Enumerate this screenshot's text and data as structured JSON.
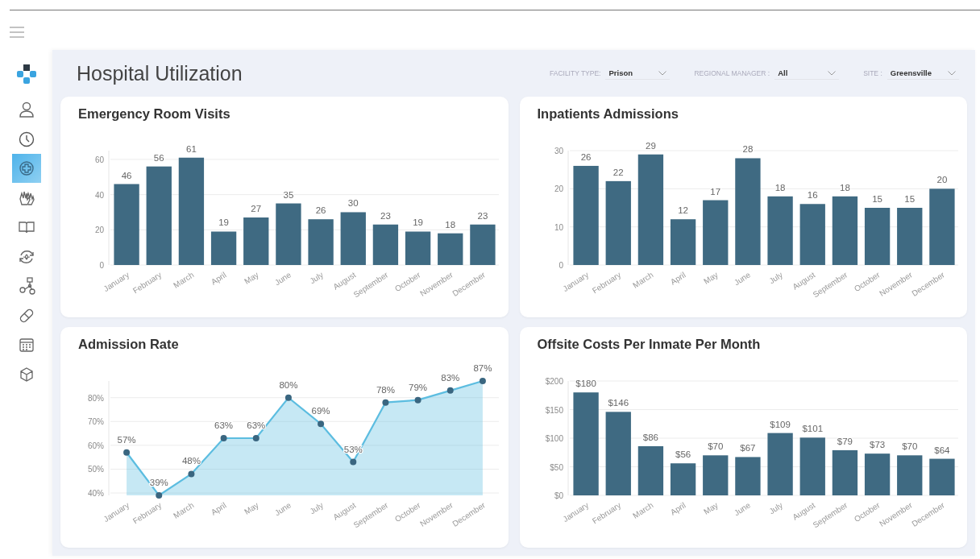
{
  "sidebar": {
    "items": [
      {
        "selected": false
      },
      {
        "selected": false
      },
      {
        "selected": true
      },
      {
        "selected": false
      },
      {
        "selected": false
      },
      {
        "selected": false
      },
      {
        "selected": false
      },
      {
        "selected": false
      },
      {
        "selected": false
      },
      {
        "selected": false
      }
    ]
  },
  "header": {
    "title": "Hospital Utilization"
  },
  "filters": [
    {
      "label": "FACILITY TYPE:",
      "value": "Prison"
    },
    {
      "label": "REGIONAL MANAGER :",
      "value": "All"
    },
    {
      "label": "SITE :",
      "value": "Greensville"
    }
  ],
  "cards": [
    {
      "title": "Emergency Room Visits",
      "chart_data": {
        "type": "bar",
        "categories": [
          "January",
          "February",
          "March",
          "April",
          "May",
          "June",
          "July",
          "August",
          "September",
          "October",
          "November",
          "December"
        ],
        "series": [
          {
            "color": "#3f6a82",
            "values": [
              46,
              56,
              61,
              19,
              27,
              35,
              26,
              30,
              23,
              19,
              18,
              23
            ]
          }
        ],
        "grid": true,
        "ylim": [
          0,
          65
        ],
        "yticks": [
          0,
          20,
          40,
          60
        ],
        "value_labels": [
          "46",
          "56",
          "61",
          "19",
          "27",
          "35",
          "26",
          "30",
          "23",
          "19",
          "18",
          "23"
        ]
      }
    },
    {
      "title": "Inpatients Admissions",
      "chart_data": {
        "type": "bar",
        "categories": [
          "January",
          "February",
          "March",
          "April",
          "May",
          "June",
          "July",
          "August",
          "September",
          "October",
          "November",
          "December"
        ],
        "series": [
          {
            "color": "#3f6a82",
            "values": [
              26,
              22,
              29,
              12,
              17,
              28,
              18,
              16,
              18,
              15,
              15,
              20
            ]
          }
        ],
        "grid": true,
        "ylim": [
          0,
          30
        ],
        "yticks": [
          0,
          10,
          20,
          30
        ],
        "value_labels": [
          "26",
          "22",
          "29",
          "12",
          "17",
          "28",
          "18",
          "16",
          "18",
          "15",
          "15",
          "20"
        ]
      }
    },
    {
      "title": "Admission Rate",
      "chart_data": {
        "type": "area",
        "categories": [
          "January",
          "February",
          "March",
          "April",
          "May",
          "June",
          "July",
          "August",
          "September",
          "October",
          "November",
          "December"
        ],
        "series": [
          {
            "color": "#5cbde0",
            "values": [
              57,
              39,
              48,
              63,
              63,
              80,
              69,
              53,
              78,
              79,
              83,
              87
            ]
          }
        ],
        "grid": true,
        "ylim": [
          39,
          87
        ],
        "yticks": [
          {
            "value": 40,
            "label": "40%"
          },
          {
            "value": 50,
            "label": "50%"
          },
          {
            "value": 60,
            "label": "60%"
          },
          {
            "value": 70,
            "label": "70%"
          },
          {
            "value": 80,
            "label": "80%"
          }
        ],
        "value_labels": [
          "57%",
          "39%",
          "48%",
          "63%",
          "63%",
          "80%",
          "69%",
          "53%",
          "78%",
          "79%",
          "83%",
          "87%"
        ]
      }
    },
    {
      "title": "Offsite Costs Per Inmate Per Month",
      "chart_data": {
        "type": "bar",
        "categories": [
          "January",
          "February",
          "March",
          "April",
          "May",
          "June",
          "July",
          "August",
          "September",
          "October",
          "November",
          "December"
        ],
        "series": [
          {
            "color": "#3f6a82",
            "values": [
              180,
              146,
              86,
              56,
              70,
              67,
              109,
              101,
              79,
              73,
              70,
              64
            ]
          }
        ],
        "grid": true,
        "ylim": [
          0,
          200
        ],
        "yticks": [
          {
            "value": 0,
            "label": "$0"
          },
          {
            "value": 50,
            "label": "$50"
          },
          {
            "value": 100,
            "label": "$100"
          },
          {
            "value": 150,
            "label": "$150"
          },
          {
            "value": 200,
            "label": "$200"
          }
        ],
        "value_labels": [
          "$180",
          "$146",
          "$86",
          "$56",
          "$70",
          "$67",
          "$109",
          "$101",
          "$79",
          "$73",
          "$70",
          "$64"
        ]
      }
    }
  ]
}
